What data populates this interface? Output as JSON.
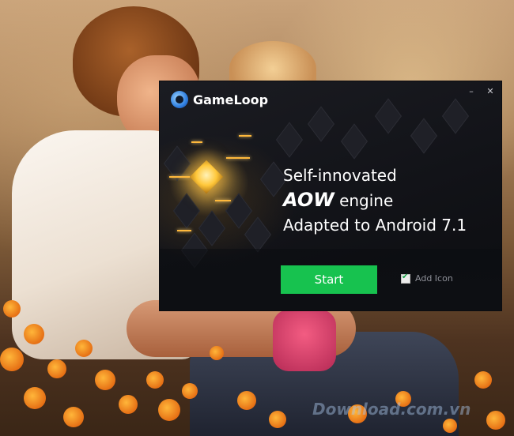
{
  "window": {
    "logo_text": "GameLoop",
    "minimize_glyph": "–",
    "close_glyph": "✕",
    "headline_line1": "Self-innovated",
    "headline_line2_bold": "AOW",
    "headline_line2_rest": " engine",
    "headline_line3": "Adapted to Android 7.1",
    "start_label": "Start",
    "add_icon_label": "Add Icon",
    "add_icon_checked": true
  },
  "watermark": {
    "text": "Download.com.vn"
  },
  "colors": {
    "start_button": "#17c24f",
    "window_bg": "#15161b",
    "accent_glow": "#ffc73a"
  },
  "icons": {
    "logo": "gameloop-logo-icon",
    "checkbox": "check-icon"
  }
}
